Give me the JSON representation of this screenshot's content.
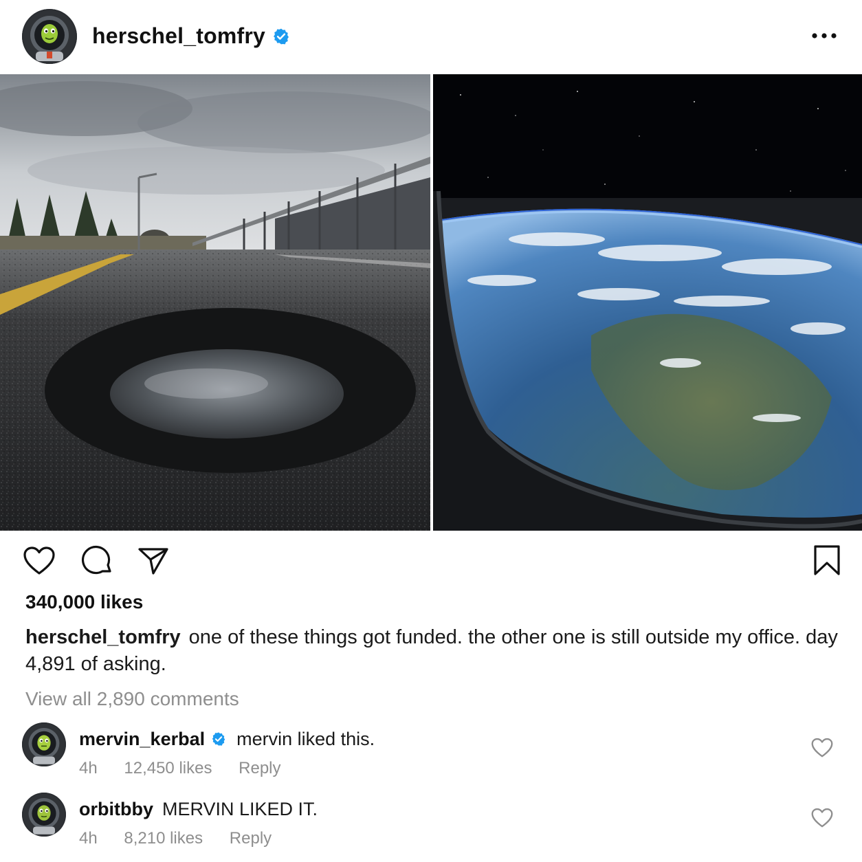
{
  "post": {
    "author": {
      "username": "herschel_tomfry",
      "verified": true,
      "avatar_icon": "astronaut-avatar"
    },
    "more_icon": "ellipsis-horizontal-icon",
    "images": [
      {
        "name": "pothole-road-photo",
        "description_icon": "pothole-photo"
      },
      {
        "name": "earth-from-orbit-photo",
        "description_icon": "earth-window-photo"
      }
    ],
    "actions": {
      "like_icon": "heart-icon",
      "comment_icon": "comment-bubble-icon",
      "share_icon": "paper-plane-icon",
      "save_icon": "bookmark-icon"
    },
    "likes_text": "340,000 likes",
    "caption": {
      "username": "herschel_tomfry",
      "text": "one of these things got funded. the other one is still outside my office. day 4,891 of asking."
    },
    "view_all_comments": "View all 2,890 comments"
  },
  "comments": [
    {
      "username": "mervin_kerbal",
      "verified": true,
      "text": "mervin liked this.",
      "time": "4h",
      "likes": "12,450 likes",
      "reply_label": "Reply"
    },
    {
      "username": "orbitbby",
      "verified": false,
      "text": "MERVIN LIKED IT.",
      "time": "4h",
      "likes": "8,210 likes",
      "reply_label": "Reply"
    }
  ],
  "colors": {
    "verified_blue": "#1D9BF0",
    "text_primary": "#111111",
    "text_secondary": "#8E8E8E",
    "background": "#FFFFFF"
  }
}
